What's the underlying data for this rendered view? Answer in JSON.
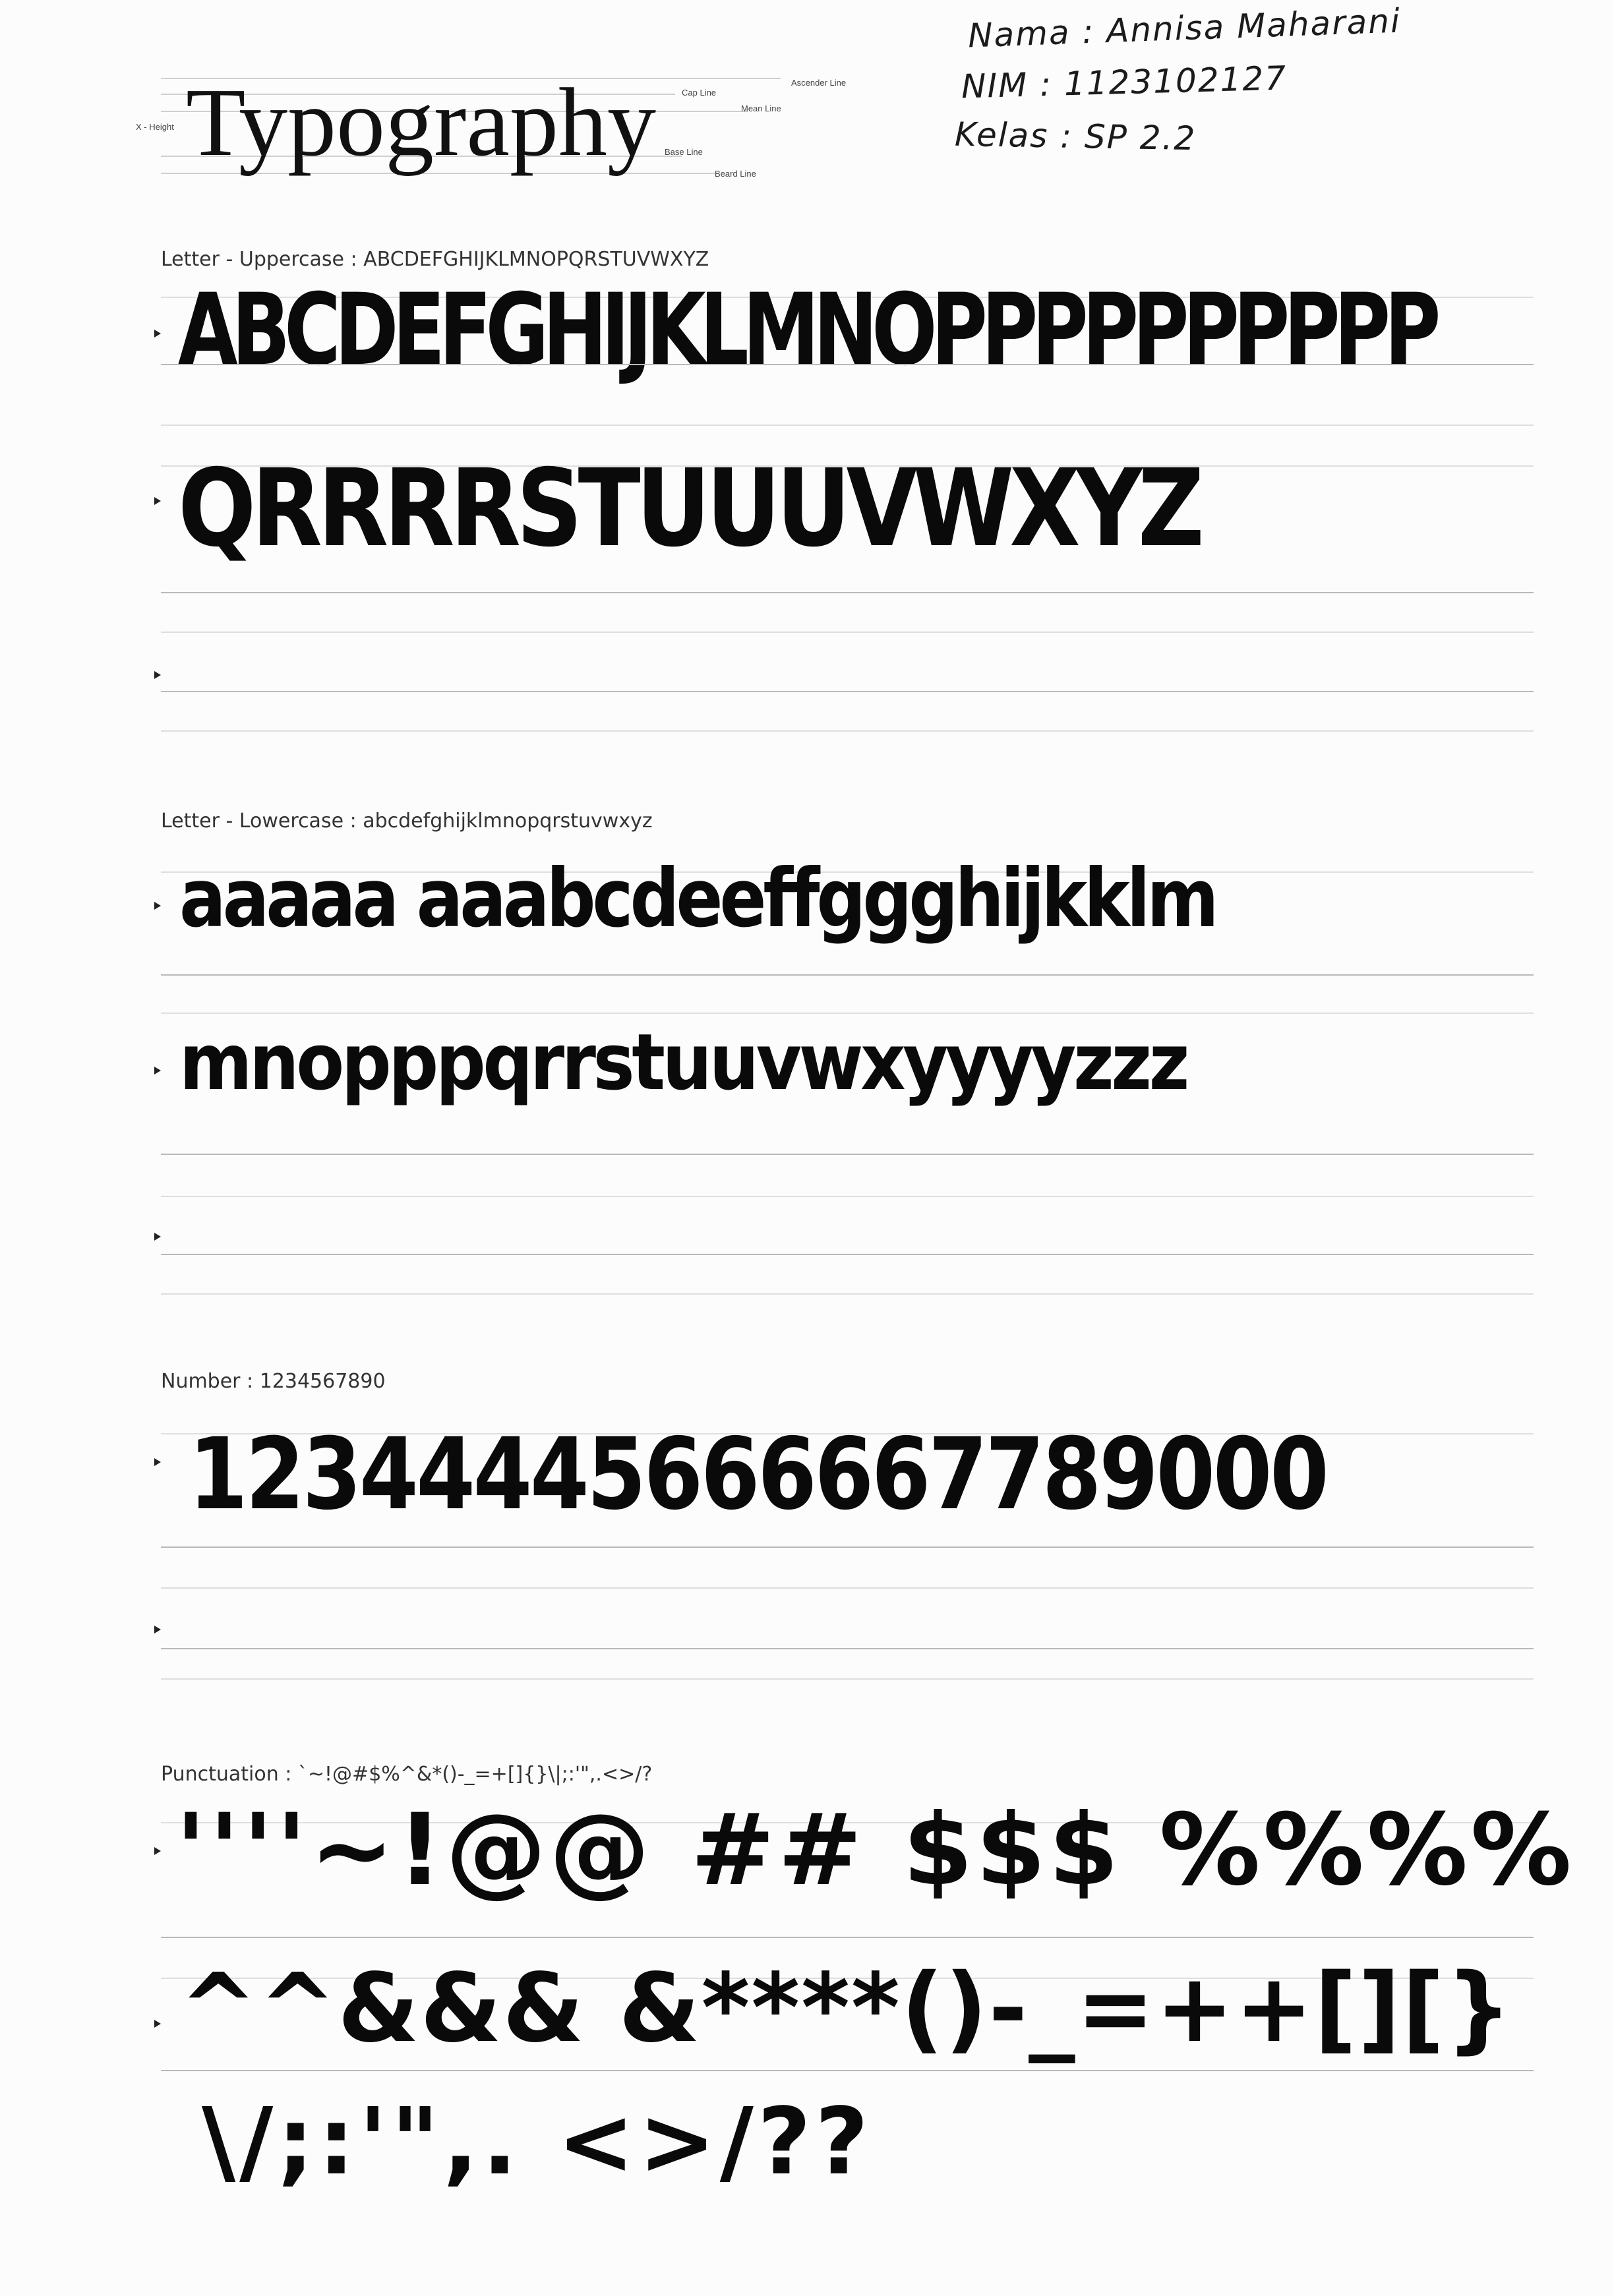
{
  "header": {
    "title": "Typography",
    "guide_labels": {
      "ascender": "Ascender Line",
      "cap": "Cap Line",
      "mean": "Mean Line",
      "x_height": "X - Height",
      "base": "Base Line",
      "beard": "Beard Line"
    }
  },
  "student": {
    "name_line": "Nama : Annisa Maharani",
    "nim_line": "NIM : 1123102127",
    "class_line": "Kelas : SP 2.2"
  },
  "sections": {
    "uppercase": {
      "label": "Letter - Uppercase : ABCDEFGHIJKLMNOPQRSTUVWXYZ",
      "row1": "ABCDEFGHIJKLMNOPPPPPPPPPP",
      "row2": "QRRRRSTUUUVWXYZ"
    },
    "lowercase": {
      "label": "Letter - Lowercase : abcdefghijklmnopqrstuvwxyz",
      "row1": "aaaaa aaabcdeeffggghijkklm",
      "row2": "mnopppqrrstuuvwxyyyyzzz"
    },
    "number": {
      "label": "Number : 1234567890",
      "row1": "12344445666667789000"
    },
    "punctuation": {
      "label": "Punctuation : `~!@#$%^&*()-_=+[]{}\\|;:'\",.<>/?",
      "row1": "''''~!@@ ## $$$ %%%%",
      "row2": "^^&&& &****()-_=++[][}",
      "row3": "\\/;:'\",. <>/??"
    }
  },
  "colors": {
    "ink": "#0a0a0a",
    "rule": "#b9b9b9",
    "rule_light": "#dedede",
    "paper": "#fcfcfc"
  }
}
